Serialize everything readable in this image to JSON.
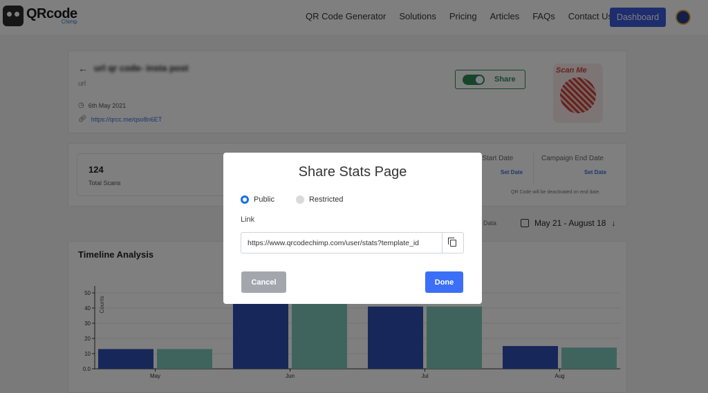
{
  "nav": {
    "logo_main": "QRcode",
    "logo_sub": "Chimp",
    "links": [
      "QR Code Generator",
      "Solutions",
      "Pricing",
      "Articles",
      "FAQs",
      "Contact Us"
    ],
    "dashboard_label": "Dashboard"
  },
  "qr": {
    "title": "url qr code- insta post",
    "type": "url",
    "date": "6th May 2021",
    "link": "https://qrcc.me/qso8n6ET",
    "share_label": "Share",
    "share_enabled": true,
    "thumb_text": "Scan Me"
  },
  "stats": {
    "total_scans": "124",
    "total_scans_label": "Total Scans",
    "campaign_start_label": "n Start Date",
    "campaign_start_value": "Set Date",
    "campaign_end_label": "Campaign End Date",
    "campaign_end_value": "Set Date",
    "campaign_note": "QR Code will be deactivated on end date."
  },
  "toolbar": {
    "export_label": "ort Data",
    "date_range": "May 21 - August 18"
  },
  "chart_data": {
    "type": "bar",
    "title": "Timeline Analysis",
    "ylabel": "Counts",
    "categories": [
      "May",
      "Jun",
      "Jul",
      "Aug"
    ],
    "series": [
      {
        "values": [
          13,
          55,
          41,
          15
        ],
        "color": "#2f4fb3"
      },
      {
        "values": [
          13,
          55,
          41,
          14
        ],
        "color": "#7fc8bb"
      }
    ],
    "ylim": [
      0,
      50
    ],
    "yticks": [
      "0.0",
      "10",
      "20",
      "30",
      "40",
      "50"
    ],
    "grid": true
  },
  "modal": {
    "title": "Share Stats Page",
    "option_public": "Public",
    "option_restricted": "Restricted",
    "selected": "Public",
    "link_label": "Link",
    "link_value": "https://www.qrcodechimp.com/user/stats?template_id",
    "cancel_label": "Cancel",
    "done_label": "Done"
  }
}
